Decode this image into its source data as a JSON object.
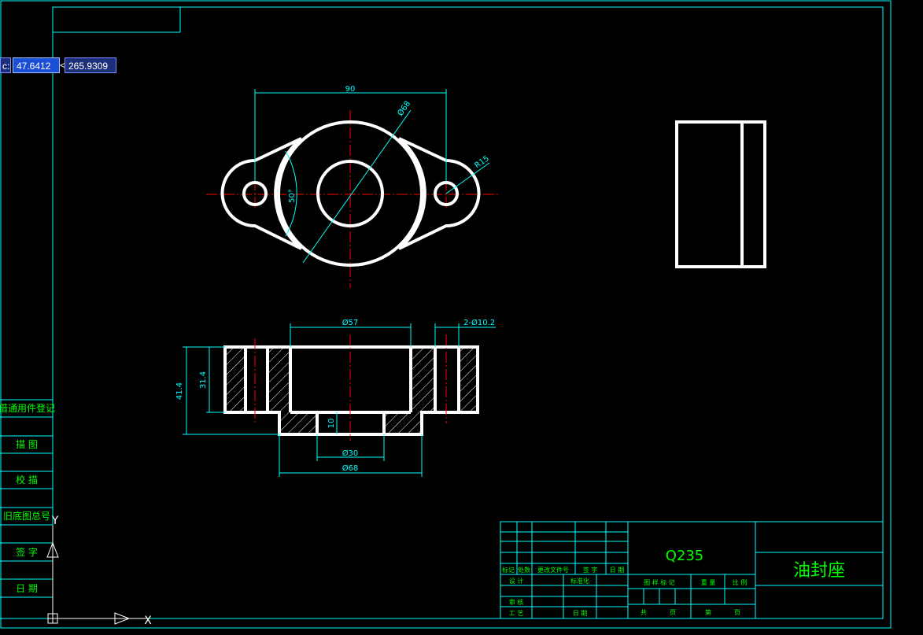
{
  "colors": {
    "background": "#000000",
    "border": "#00ffff",
    "part": "#ffffff",
    "dimension": "#00ffff",
    "centerline": "#ff0000",
    "title_text": "#00ff00"
  },
  "coordinate_input": {
    "prefix": "c:",
    "x_value": "47.6412",
    "separator": "<",
    "y_value": "265.9309"
  },
  "left_strip": {
    "labels": [
      "借通用件登记",
      "描 图",
      "校 描",
      "旧底图总号",
      "签 字",
      "日 期"
    ]
  },
  "dimensions": {
    "top_width": "90",
    "top_dia": "Ø68",
    "top_radius": "R15",
    "top_angle": "50°",
    "sec_dia57": "Ø57",
    "sec_holes": "2-Ø10.2",
    "sec_h1": "41.4",
    "sec_h2": "31.4",
    "sec_step": "10",
    "sec_dia30": "Ø30",
    "sec_dia68": "Ø68"
  },
  "title_block": {
    "material": "Q235",
    "part_name": "油封座",
    "rev_headers": [
      "标记",
      "处数",
      "更改文件号",
      "签 字",
      "日 期"
    ],
    "row_design": "设 计",
    "row_std": "标准化",
    "row_review": "审 核",
    "row_process": "工 艺",
    "row_date": "日 期",
    "col_stage": "图 样 标 记",
    "col_weight": "重 量",
    "col_scale": "比 例",
    "total": "共",
    "page_unit": "页",
    "page_no": "第",
    "page_unit2": "页"
  },
  "ucs_icon": {
    "y_label": "Y",
    "x_label": "X"
  }
}
